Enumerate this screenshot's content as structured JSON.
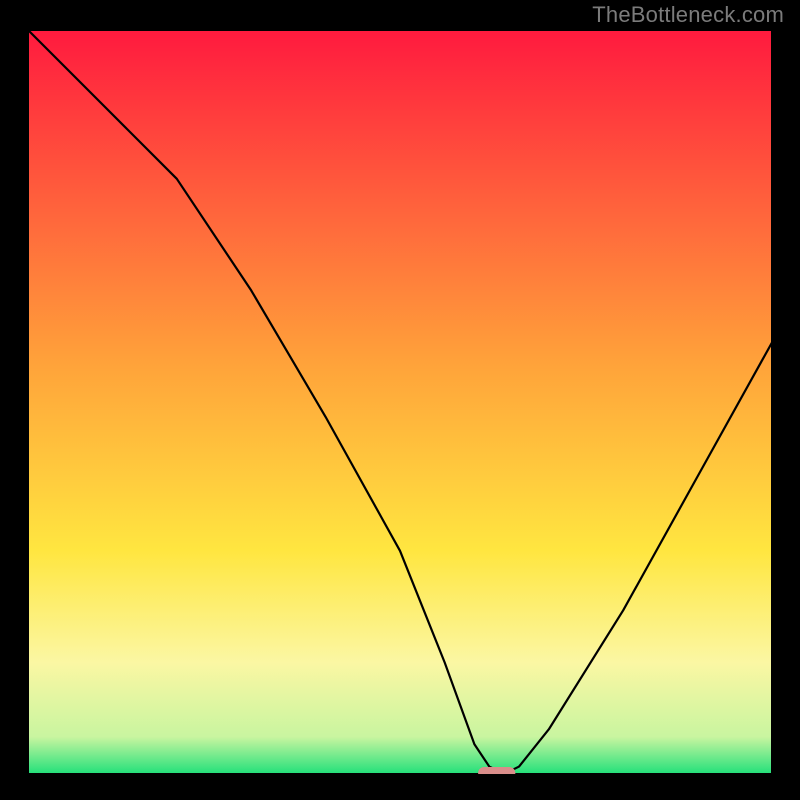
{
  "watermark": "TheBottleneck.com",
  "chart_data": {
    "type": "line",
    "title": "",
    "xlabel": "",
    "ylabel": "",
    "xlim": [
      0,
      100
    ],
    "ylim": [
      0,
      100
    ],
    "x": [
      0,
      10,
      20,
      30,
      40,
      50,
      56,
      60,
      62,
      64,
      66,
      70,
      80,
      90,
      100
    ],
    "values": [
      100,
      90,
      80,
      65,
      48,
      30,
      15,
      4,
      1,
      0,
      1,
      6,
      22,
      40,
      58
    ],
    "minimum_marker": {
      "x": 63,
      "y": 0,
      "width": 5
    },
    "background_gradient": {
      "stops": [
        {
          "offset": 0.0,
          "color": "#ff1a3e"
        },
        {
          "offset": 0.45,
          "color": "#ffa33a"
        },
        {
          "offset": 0.7,
          "color": "#ffe640"
        },
        {
          "offset": 0.85,
          "color": "#fbf7a3"
        },
        {
          "offset": 0.95,
          "color": "#c9f5a0"
        },
        {
          "offset": 1.0,
          "color": "#22e07a"
        }
      ]
    },
    "line_color": "#000000",
    "marker_color": "#d98d8a"
  }
}
